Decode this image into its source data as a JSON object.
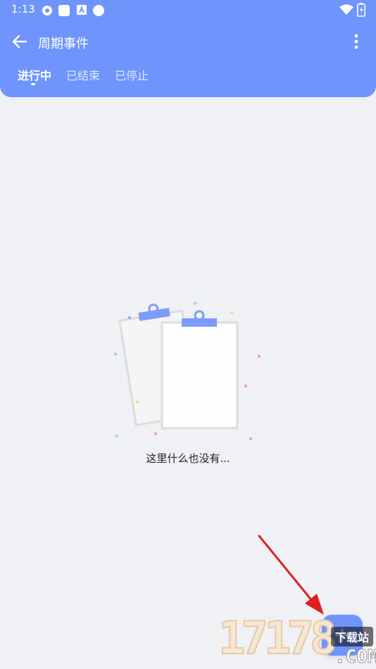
{
  "status_bar": {
    "time": "1:13"
  },
  "toolbar": {
    "title": "周期事件",
    "back_icon": "arrow-left-icon",
    "more_icon": "more-vert-icon"
  },
  "tabs": [
    {
      "label": "进行中",
      "active": true
    },
    {
      "label": "已结束",
      "active": false
    },
    {
      "label": "已停止",
      "active": false
    }
  ],
  "empty_state": {
    "message": "这里什么也没有..."
  },
  "fab": {
    "icon": "plus-icon"
  },
  "watermark": {
    "digits": "17178",
    "badge": "下载站",
    "suffix": ".COM"
  },
  "colors": {
    "primary": "#6f95fc",
    "background": "#f0f1f5",
    "annotation_arrow": "#e02020"
  }
}
